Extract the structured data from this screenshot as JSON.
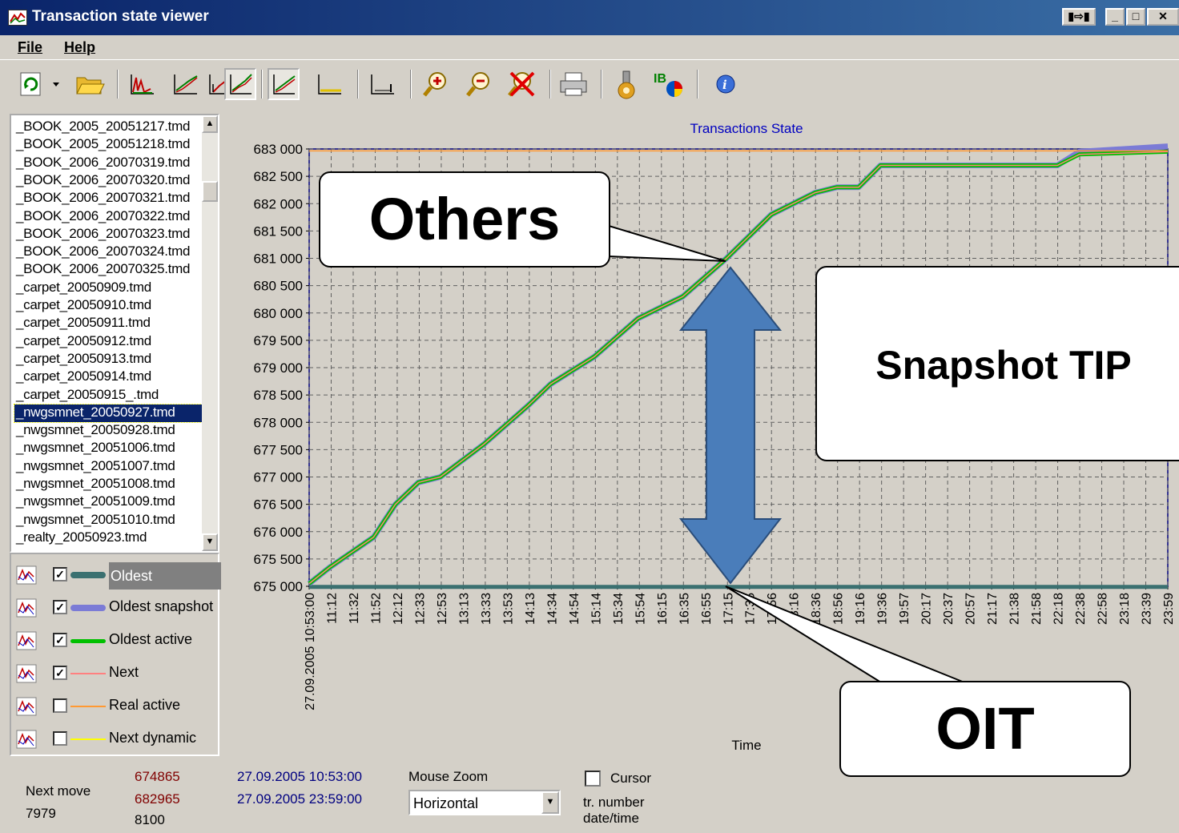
{
  "window": {
    "title": "Transaction state viewer"
  },
  "menu": {
    "file": "File",
    "help": "Help"
  },
  "toolbar": {
    "icons": [
      "refresh-icon",
      "dropdown-arrow-icon",
      "open-folder-icon",
      "chart-type-1-icon",
      "chart-type-2-icon",
      "chart-type-3-icon",
      "line-chart-icon",
      "area-chart-icon",
      "bar-chart-icon",
      "zoom-in-icon",
      "zoom-out-icon",
      "zoom-reset-icon",
      "print-icon",
      "settings-icon",
      "database-icon",
      "info-icon"
    ]
  },
  "files": [
    "_BOOK_2005_20051217.tmd",
    "_BOOK_2005_20051218.tmd",
    "_BOOK_2006_20070319.tmd",
    "_BOOK_2006_20070320.tmd",
    "_BOOK_2006_20070321.tmd",
    "_BOOK_2006_20070322.tmd",
    "_BOOK_2006_20070323.tmd",
    "_BOOK_2006_20070324.tmd",
    "_BOOK_2006_20070325.tmd",
    "_carpet_20050909.tmd",
    "_carpet_20050910.tmd",
    "_carpet_20050911.tmd",
    "_carpet_20050912.tmd",
    "_carpet_20050913.tmd",
    "_carpet_20050914.tmd",
    "_carpet_20050915_.tmd",
    "_nwgsmnet_20050927.tmd",
    "_nwgsmnet_20050928.tmd",
    "_nwgsmnet_20051006.tmd",
    "_nwgsmnet_20051007.tmd",
    "_nwgsmnet_20051008.tmd",
    "_nwgsmnet_20051009.tmd",
    "_nwgsmnet_20051010.tmd",
    "_realty_20050923.tmd"
  ],
  "selected_file_index": 16,
  "legend": [
    {
      "label": "Oldest",
      "checked": true,
      "color": "#3a7070"
    },
    {
      "label": "Oldest snapshot",
      "checked": true,
      "color": "#7b7bd6"
    },
    {
      "label": "Oldest active",
      "checked": true,
      "color": "#00c000"
    },
    {
      "label": "Next",
      "checked": true,
      "color": "#ff8080"
    },
    {
      "label": "Real active",
      "checked": false,
      "color": "#ff9933"
    },
    {
      "label": "Next dynamic",
      "checked": false,
      "color": "#ffff00"
    }
  ],
  "chart_data": {
    "type": "line",
    "title": "Transactions State",
    "xlabel": "Time",
    "ylabel": "",
    "ylim": [
      675000,
      683000
    ],
    "yticks": [
      "675 000",
      "675 500",
      "676 000",
      "676 500",
      "677 000",
      "677 500",
      "678 000",
      "678 500",
      "679 000",
      "679 500",
      "680 000",
      "680 500",
      "681 000",
      "681 500",
      "682 000",
      "682 500",
      "683 000"
    ],
    "xticks": [
      "27.09.2005 10:53:00",
      "11:12",
      "11:32",
      "11:52",
      "12:12",
      "12:33",
      "12:53",
      "13:13",
      "13:33",
      "13:53",
      "14:13",
      "14:34",
      "14:54",
      "15:14",
      "15:34",
      "15:54",
      "16:15",
      "16:35",
      "16:55",
      "17:15",
      "17:35",
      "17:56",
      "18:16",
      "18:36",
      "18:56",
      "19:16",
      "19:36",
      "19:57",
      "20:17",
      "20:37",
      "20:57",
      "21:17",
      "21:38",
      "21:58",
      "22:18",
      "22:38",
      "22:58",
      "23:18",
      "23:39",
      "23:59"
    ],
    "grid": true,
    "series": [
      {
        "name": "Oldest",
        "x": [
          "10:53",
          "23:59"
        ],
        "y": [
          674990,
          674990
        ]
      },
      {
        "name": "Oldest snapshot",
        "x": [
          "10:53",
          "11:12",
          "11:52",
          "12:12",
          "12:33",
          "12:53",
          "13:33",
          "14:13",
          "14:34",
          "15:14",
          "15:54",
          "16:35",
          "17:15",
          "17:56",
          "18:36",
          "18:56",
          "19:16",
          "19:36",
          "22:18",
          "22:38",
          "23:59"
        ],
        "y": [
          675050,
          675350,
          675900,
          676500,
          676900,
          677000,
          677600,
          678300,
          678700,
          679200,
          679900,
          680300,
          681000,
          681800,
          682200,
          682300,
          682300,
          682700,
          682700,
          682950,
          683050
        ]
      },
      {
        "name": "Oldest active",
        "x": [
          "10:53",
          "11:12",
          "11:52",
          "12:12",
          "12:33",
          "12:53",
          "13:33",
          "14:13",
          "14:34",
          "15:14",
          "15:54",
          "16:35",
          "17:15",
          "17:56",
          "18:36",
          "18:56",
          "19:16",
          "19:36",
          "22:18",
          "22:38",
          "23:59"
        ],
        "y": [
          675050,
          675350,
          675900,
          676500,
          676900,
          677000,
          677600,
          678300,
          678700,
          679200,
          679900,
          680300,
          681000,
          681800,
          682200,
          682300,
          682300,
          682700,
          682700,
          682900,
          682950
        ]
      },
      {
        "name": "Next",
        "x": [
          "10:53",
          "11:12",
          "11:52",
          "12:12",
          "12:33",
          "12:53",
          "13:33",
          "14:13",
          "14:34",
          "15:14",
          "15:54",
          "16:35",
          "17:15",
          "17:56",
          "18:36",
          "18:56",
          "19:16",
          "19:36",
          "22:18",
          "22:38",
          "23:59"
        ],
        "y": [
          675050,
          675350,
          675900,
          676500,
          676900,
          677000,
          677600,
          678300,
          678700,
          679200,
          679900,
          680300,
          681000,
          681800,
          682200,
          682300,
          682300,
          682700,
          682700,
          682900,
          682950
        ]
      },
      {
        "name": "Real active",
        "x": [
          "10:53",
          "23:59"
        ],
        "y": [
          682965,
          682965
        ]
      }
    ]
  },
  "status": {
    "next_move_label": "Next move",
    "next_move_value": "7979",
    "tr_min": "674865",
    "tr_max": "682965",
    "tr_diff": "8100",
    "date_min": "27.09.2005 10:53:00",
    "date_max": "27.09.2005 23:59:00",
    "mouse_zoom_label": "Mouse Zoom",
    "mouse_zoom_value": "Horizontal",
    "cursor_label": "Cursor",
    "tr_number_label": "tr. number",
    "date_time_label": "date/time"
  },
  "callouts": {
    "others": "Others",
    "snapshot_tip": "Snapshot TIP",
    "oit": "OIT"
  },
  "colors": {
    "arrow": "#4a7dba",
    "plot_bg": "#d4d0c8",
    "title": "#0000c0"
  }
}
